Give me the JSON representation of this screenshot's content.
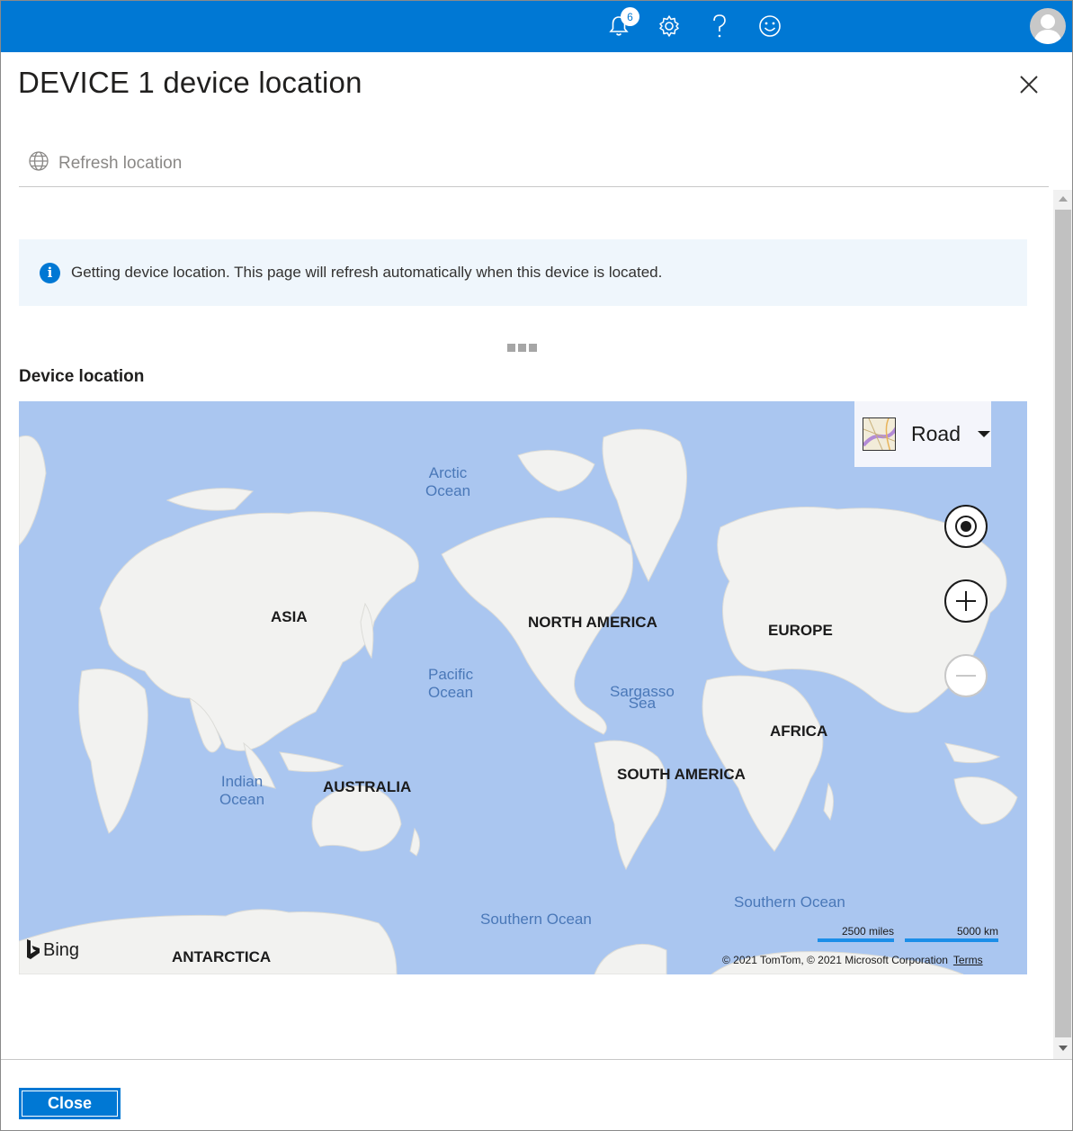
{
  "topbar": {
    "notification_count": "6",
    "icons": [
      "bell-icon",
      "gear-icon",
      "help-icon",
      "smiley-icon",
      "avatar"
    ]
  },
  "header": {
    "title": "DEVICE 1 device location"
  },
  "command_bar": {
    "refresh_label": "Refresh location"
  },
  "info_banner": {
    "icon": "info-icon",
    "message": "Getting device location. This page will refresh automatically when this device is located."
  },
  "section": {
    "label": "Device location"
  },
  "map": {
    "style_label": "Road",
    "continents": {
      "asia": "ASIA",
      "north_america": "NORTH AMERICA",
      "europe": "EUROPE",
      "africa": "AFRICA",
      "south_america": "SOUTH AMERICA",
      "australia": "AUSTRALIA",
      "antarctica": "ANTARCTICA"
    },
    "oceans": {
      "arctic_1": "Arctic",
      "arctic_2": "Ocean",
      "pacific_1": "Pacific",
      "pacific_2": "Ocean",
      "sargasso_1": "Sargasso",
      "sargasso_2": "Sea",
      "indian_1": "Indian",
      "indian_2": "Ocean",
      "southern_1": "Southern Ocean",
      "southern_2": "Southern Ocean"
    },
    "bing_label": "Bing",
    "scale_miles": "2500 miles",
    "scale_km": "5000 km",
    "copyright": "© 2021 TomTom, © 2021 Microsoft Corporation",
    "terms_label": "Terms",
    "colors": {
      "water": "#aac6f0",
      "land": "#f2f2f0"
    }
  },
  "footer": {
    "close_label": "Close"
  },
  "colors": {
    "accent": "#0078d4",
    "banner": "#eff6fc"
  }
}
